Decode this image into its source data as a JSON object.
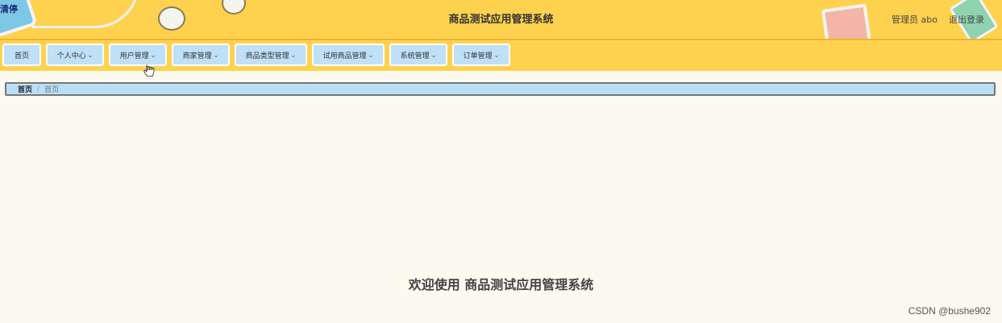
{
  "header": {
    "corner_text": "清停",
    "title": "商品测试应用管理系统",
    "user_label": "管理员 abo",
    "logout_label": "退出登录"
  },
  "nav": {
    "items": [
      {
        "label": "首页",
        "has_dropdown": false
      },
      {
        "label": "个人中心",
        "has_dropdown": true
      },
      {
        "label": "用户管理",
        "has_dropdown": true
      },
      {
        "label": "商家管理",
        "has_dropdown": true
      },
      {
        "label": "商品类型管理",
        "has_dropdown": true
      },
      {
        "label": "试用商品管理",
        "has_dropdown": true
      },
      {
        "label": "系统管理",
        "has_dropdown": true
      },
      {
        "label": "订单管理",
        "has_dropdown": true
      }
    ],
    "chevron": "⌄"
  },
  "breadcrumb": {
    "home": "首页",
    "separator": "/",
    "current": "首页"
  },
  "main": {
    "welcome": "欢迎使用 商品测试应用管理系统"
  },
  "watermark": "CSDN @bushe902",
  "colors": {
    "header_bg": "#fed24e",
    "nav_item_bg": "#bfe0f7",
    "page_bg": "#fcf9ef"
  }
}
